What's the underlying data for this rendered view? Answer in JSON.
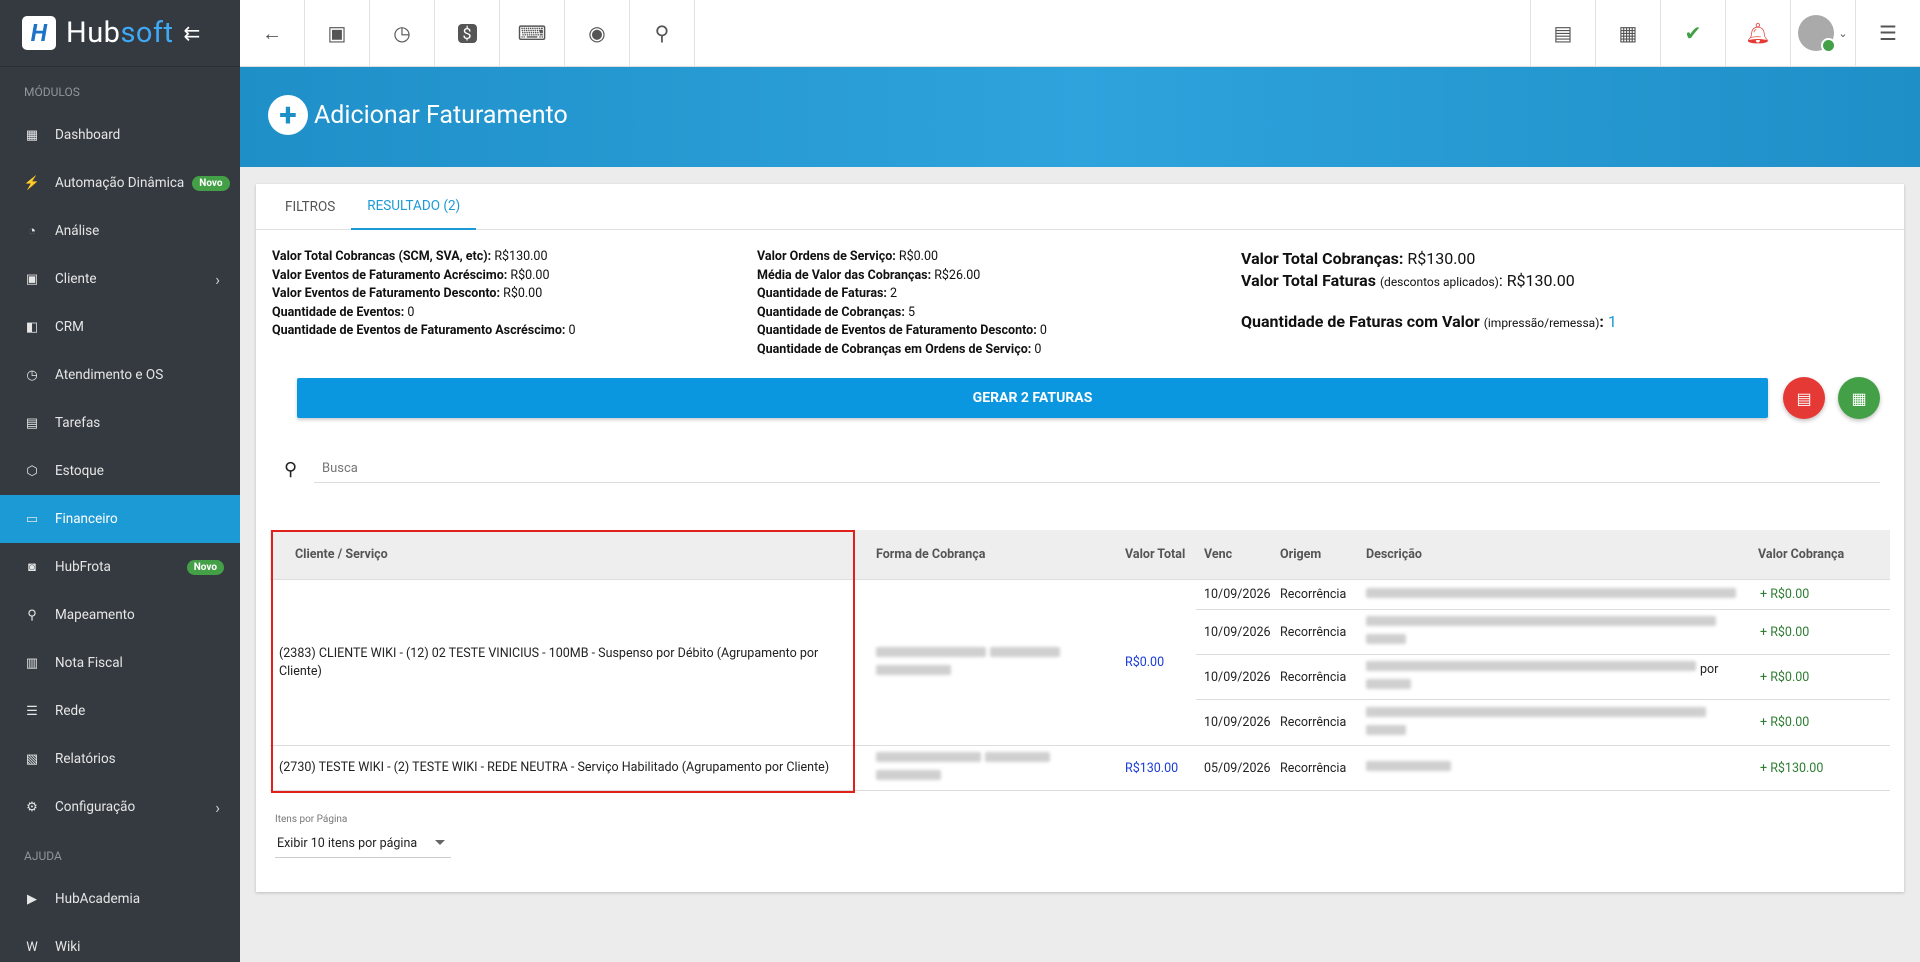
{
  "brand": {
    "name_a": "Hub",
    "name_b": "soft"
  },
  "sidebar": {
    "section_modules": "MÓDULOS",
    "section_help": "AJUDA",
    "items": [
      {
        "label": "Dashboard",
        "icon": "dashboard-icon"
      },
      {
        "label": "Automação Dinâmica",
        "icon": "automation-icon",
        "badge": "Novo"
      },
      {
        "label": "Análise",
        "icon": "chart-pie-icon"
      },
      {
        "label": "Cliente",
        "icon": "contact-icon"
      },
      {
        "label": "CRM",
        "icon": "crm-icon"
      },
      {
        "label": "Atendimento e OS",
        "icon": "clock-icon"
      },
      {
        "label": "Tarefas",
        "icon": "tasks-icon"
      },
      {
        "label": "Estoque",
        "icon": "box-icon"
      },
      {
        "label": "Financeiro",
        "icon": "finance-icon"
      },
      {
        "label": "HubFrota",
        "icon": "car-icon",
        "badge": "Novo"
      },
      {
        "label": "Mapeamento",
        "icon": "map-pin-icon"
      },
      {
        "label": "Nota Fiscal",
        "icon": "document-icon"
      },
      {
        "label": "Rede",
        "icon": "server-icon"
      },
      {
        "label": "Relatórios",
        "icon": "report-icon"
      },
      {
        "label": "Configuração",
        "icon": "gear-icon"
      }
    ],
    "help_items": [
      {
        "label": "HubAcademia",
        "icon": "youtube-icon"
      },
      {
        "label": "Wiki",
        "icon": "wiki-icon"
      }
    ]
  },
  "page": {
    "title": "Adicionar Faturamento"
  },
  "tabs": [
    {
      "label": "FILTROS"
    },
    {
      "label": "RESULTADO (2)"
    }
  ],
  "summary": {
    "col1": [
      {
        "k": "Valor Total Cobrancas (SCM, SVA, etc):",
        "v": " R$130.00"
      },
      {
        "k": "Valor Eventos de Faturamento Acréscimo:",
        "v": " R$0.00"
      },
      {
        "k": "Valor Eventos de Faturamento Desconto:",
        "v": " R$0.00"
      },
      {
        "k": "Quantidade de Eventos:",
        "v": " 0"
      },
      {
        "k": "Quantidade de Eventos de Faturamento Ascréscimo:",
        "v": " 0"
      }
    ],
    "col2": [
      {
        "k": "Valor Ordens de Serviço:",
        "v": " R$0.00"
      },
      {
        "k": "Média de Valor das Cobranças:",
        "v": " R$26.00"
      },
      {
        "k": "Quantidade de Faturas:",
        "v": " 2"
      },
      {
        "k": "Quantidade de Cobranças:",
        "v": " 5"
      },
      {
        "k": "Quantidade de Eventos de Faturamento Desconto:",
        "v": " 0"
      },
      {
        "k": "Quantidade de Cobranças em Ordens de Serviço:",
        "v": " 0"
      }
    ],
    "big": {
      "total_cobrancas_k": "Valor Total Cobranças:",
      "total_cobrancas_v": " R$130.00",
      "total_faturas_k": "Valor Total Faturas",
      "total_faturas_note": "(descontos aplicados)",
      "total_faturas_v": ": R$130.00",
      "qtd_k": "Quantidade de Faturas com Valor",
      "qtd_note": "(impressão/remessa)",
      "qtd_v": "1"
    }
  },
  "actions": {
    "generate": "GERAR 2 FATURAS"
  },
  "search": {
    "placeholder": "Busca"
  },
  "table": {
    "headers": {
      "cliente": "Cliente / Serviço",
      "forma": "Forma de Cobrança",
      "valor_total": "Valor Total",
      "venc": "Venc",
      "origem": "Origem",
      "descricao": "Descrição",
      "valor_cobranca": "Valor Cobrança"
    },
    "groups": [
      {
        "cliente": "(2383) CLIENTE WIKI - (12) 02 TESTE VINICIUS - 100MB - Suspenso por Débito (Agrupamento por Cliente)",
        "valor_total": "R$0.00",
        "rows": [
          {
            "venc": "10/09/2026",
            "origem": "Recorrência",
            "valor": "+ R$0.00"
          },
          {
            "venc": "10/09/2026",
            "origem": "Recorrência",
            "valor": "+ R$0.00"
          },
          {
            "venc": "10/09/2026",
            "origem": "Recorrência",
            "valor": "+ R$0.00",
            "desc_tail": "por"
          },
          {
            "venc": "10/09/2026",
            "origem": "Recorrência",
            "valor": "+ R$0.00"
          }
        ]
      },
      {
        "cliente": "(2730) TESTE WIKI - (2) TESTE WIKI - REDE NEUTRA - Serviço Habilitado (Agrupamento por Cliente)",
        "valor_total": "R$130.00",
        "rows": [
          {
            "venc": "05/09/2026",
            "origem": "Recorrência",
            "valor": "+ R$130.00"
          }
        ]
      }
    ]
  },
  "pagination": {
    "label": "Itens por Página",
    "value": "Exibir 10 itens por página"
  }
}
